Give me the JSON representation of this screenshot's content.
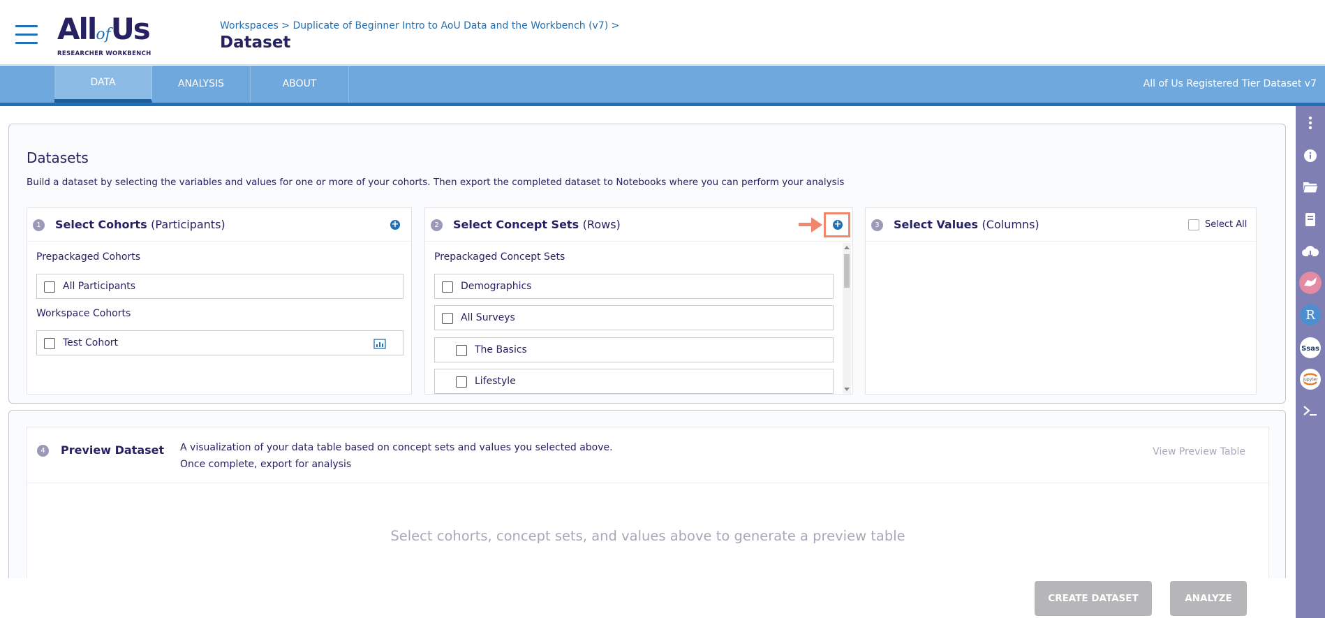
{
  "header": {
    "logo_main_all": "All",
    "logo_main_of": "of",
    "logo_main_us": "Us",
    "logo_sub": "RESEARCHER WORKBENCH",
    "breadcrumb": "Workspaces > Duplicate of Beginner Intro to AoU Data and the Workbench (v7) >",
    "title": "Dataset"
  },
  "nav": {
    "tabs": [
      {
        "label": "DATA",
        "active": true
      },
      {
        "label": "ANALYSIS",
        "active": false
      },
      {
        "label": "ABOUT",
        "active": false
      }
    ],
    "tier": "All of Us Registered Tier Dataset v7"
  },
  "datasets": {
    "title": "Datasets",
    "description": "Build a dataset by selecting the variables and values for one or more of your cohorts. Then export the completed dataset to Notebooks where you can perform your analysis"
  },
  "cohorts": {
    "step": "1",
    "title": "Select Cohorts",
    "subtitle": "(Participants)",
    "prepackaged_label": "Prepackaged Cohorts",
    "prepackaged": [
      {
        "label": "All Participants",
        "checked": false
      }
    ],
    "workspace_label": "Workspace Cohorts",
    "workspace": [
      {
        "label": "Test Cohort",
        "checked": false
      }
    ]
  },
  "concept_sets": {
    "step": "2",
    "title": "Select Concept Sets",
    "subtitle": "(Rows)",
    "prepackaged_label": "Prepackaged Concept Sets",
    "items": [
      {
        "label": "Demographics",
        "indent": false
      },
      {
        "label": "All Surveys",
        "indent": false
      },
      {
        "label": "The Basics",
        "indent": true
      },
      {
        "label": "Lifestyle",
        "indent": true
      }
    ]
  },
  "values": {
    "step": "3",
    "title": "Select Values",
    "subtitle": "(Columns)",
    "select_all": "Select All"
  },
  "preview": {
    "step": "4",
    "title": "Preview Dataset",
    "desc_line1": "A visualization of your data table based on concept sets and values you selected above.",
    "desc_line2": "Once complete, export for analysis",
    "view_link": "View Preview Table",
    "empty_message": "Select cohorts, concept sets, and values above to generate a preview table"
  },
  "actions": {
    "create": "CREATE DATASET",
    "analyze": "ANALYZE"
  },
  "sidebar_icons": [
    "more-vert-icon",
    "info-icon",
    "folder-icon",
    "book-icon",
    "cloud-icon",
    "cromwell-icon",
    "rstudio-icon",
    "sas-icon",
    "jupyter-icon",
    "terminal-icon"
  ],
  "colors": {
    "brand_navy": "#262262",
    "brand_blue": "#216fb4",
    "nav_bg": "#6fa8dc",
    "sidebar_bg": "#7f7fb3",
    "annotation": "#f0866b",
    "button_disabled": "#b6b6b9"
  }
}
